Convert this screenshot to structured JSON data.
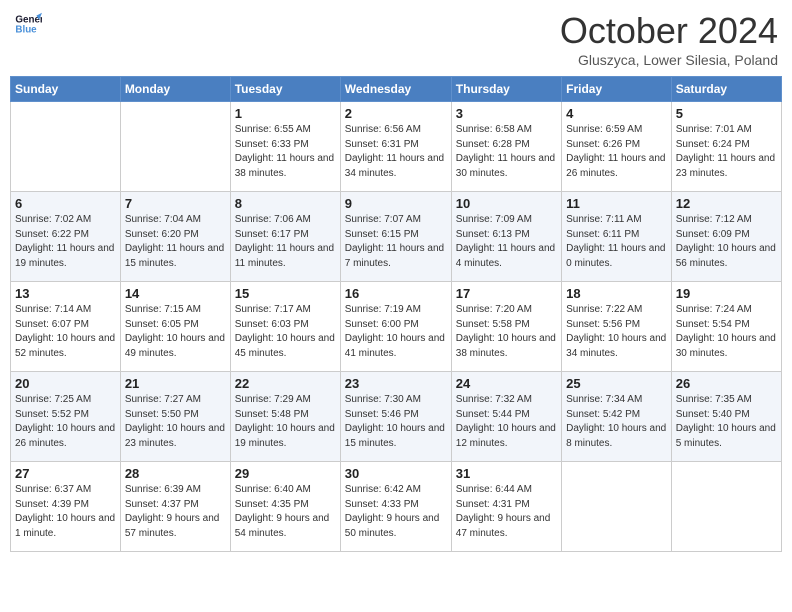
{
  "header": {
    "logo_line1": "General",
    "logo_line2": "Blue",
    "month": "October 2024",
    "location": "Gluszyca, Lower Silesia, Poland"
  },
  "weekdays": [
    "Sunday",
    "Monday",
    "Tuesday",
    "Wednesday",
    "Thursday",
    "Friday",
    "Saturday"
  ],
  "weeks": [
    [
      {
        "day": "",
        "sunrise": "",
        "sunset": "",
        "daylight": ""
      },
      {
        "day": "",
        "sunrise": "",
        "sunset": "",
        "daylight": ""
      },
      {
        "day": "1",
        "sunrise": "Sunrise: 6:55 AM",
        "sunset": "Sunset: 6:33 PM",
        "daylight": "Daylight: 11 hours and 38 minutes."
      },
      {
        "day": "2",
        "sunrise": "Sunrise: 6:56 AM",
        "sunset": "Sunset: 6:31 PM",
        "daylight": "Daylight: 11 hours and 34 minutes."
      },
      {
        "day": "3",
        "sunrise": "Sunrise: 6:58 AM",
        "sunset": "Sunset: 6:28 PM",
        "daylight": "Daylight: 11 hours and 30 minutes."
      },
      {
        "day": "4",
        "sunrise": "Sunrise: 6:59 AM",
        "sunset": "Sunset: 6:26 PM",
        "daylight": "Daylight: 11 hours and 26 minutes."
      },
      {
        "day": "5",
        "sunrise": "Sunrise: 7:01 AM",
        "sunset": "Sunset: 6:24 PM",
        "daylight": "Daylight: 11 hours and 23 minutes."
      }
    ],
    [
      {
        "day": "6",
        "sunrise": "Sunrise: 7:02 AM",
        "sunset": "Sunset: 6:22 PM",
        "daylight": "Daylight: 11 hours and 19 minutes."
      },
      {
        "day": "7",
        "sunrise": "Sunrise: 7:04 AM",
        "sunset": "Sunset: 6:20 PM",
        "daylight": "Daylight: 11 hours and 15 minutes."
      },
      {
        "day": "8",
        "sunrise": "Sunrise: 7:06 AM",
        "sunset": "Sunset: 6:17 PM",
        "daylight": "Daylight: 11 hours and 11 minutes."
      },
      {
        "day": "9",
        "sunrise": "Sunrise: 7:07 AM",
        "sunset": "Sunset: 6:15 PM",
        "daylight": "Daylight: 11 hours and 7 minutes."
      },
      {
        "day": "10",
        "sunrise": "Sunrise: 7:09 AM",
        "sunset": "Sunset: 6:13 PM",
        "daylight": "Daylight: 11 hours and 4 minutes."
      },
      {
        "day": "11",
        "sunrise": "Sunrise: 7:11 AM",
        "sunset": "Sunset: 6:11 PM",
        "daylight": "Daylight: 11 hours and 0 minutes."
      },
      {
        "day": "12",
        "sunrise": "Sunrise: 7:12 AM",
        "sunset": "Sunset: 6:09 PM",
        "daylight": "Daylight: 10 hours and 56 minutes."
      }
    ],
    [
      {
        "day": "13",
        "sunrise": "Sunrise: 7:14 AM",
        "sunset": "Sunset: 6:07 PM",
        "daylight": "Daylight: 10 hours and 52 minutes."
      },
      {
        "day": "14",
        "sunrise": "Sunrise: 7:15 AM",
        "sunset": "Sunset: 6:05 PM",
        "daylight": "Daylight: 10 hours and 49 minutes."
      },
      {
        "day": "15",
        "sunrise": "Sunrise: 7:17 AM",
        "sunset": "Sunset: 6:03 PM",
        "daylight": "Daylight: 10 hours and 45 minutes."
      },
      {
        "day": "16",
        "sunrise": "Sunrise: 7:19 AM",
        "sunset": "Sunset: 6:00 PM",
        "daylight": "Daylight: 10 hours and 41 minutes."
      },
      {
        "day": "17",
        "sunrise": "Sunrise: 7:20 AM",
        "sunset": "Sunset: 5:58 PM",
        "daylight": "Daylight: 10 hours and 38 minutes."
      },
      {
        "day": "18",
        "sunrise": "Sunrise: 7:22 AM",
        "sunset": "Sunset: 5:56 PM",
        "daylight": "Daylight: 10 hours and 34 minutes."
      },
      {
        "day": "19",
        "sunrise": "Sunrise: 7:24 AM",
        "sunset": "Sunset: 5:54 PM",
        "daylight": "Daylight: 10 hours and 30 minutes."
      }
    ],
    [
      {
        "day": "20",
        "sunrise": "Sunrise: 7:25 AM",
        "sunset": "Sunset: 5:52 PM",
        "daylight": "Daylight: 10 hours and 26 minutes."
      },
      {
        "day": "21",
        "sunrise": "Sunrise: 7:27 AM",
        "sunset": "Sunset: 5:50 PM",
        "daylight": "Daylight: 10 hours and 23 minutes."
      },
      {
        "day": "22",
        "sunrise": "Sunrise: 7:29 AM",
        "sunset": "Sunset: 5:48 PM",
        "daylight": "Daylight: 10 hours and 19 minutes."
      },
      {
        "day": "23",
        "sunrise": "Sunrise: 7:30 AM",
        "sunset": "Sunset: 5:46 PM",
        "daylight": "Daylight: 10 hours and 15 minutes."
      },
      {
        "day": "24",
        "sunrise": "Sunrise: 7:32 AM",
        "sunset": "Sunset: 5:44 PM",
        "daylight": "Daylight: 10 hours and 12 minutes."
      },
      {
        "day": "25",
        "sunrise": "Sunrise: 7:34 AM",
        "sunset": "Sunset: 5:42 PM",
        "daylight": "Daylight: 10 hours and 8 minutes."
      },
      {
        "day": "26",
        "sunrise": "Sunrise: 7:35 AM",
        "sunset": "Sunset: 5:40 PM",
        "daylight": "Daylight: 10 hours and 5 minutes."
      }
    ],
    [
      {
        "day": "27",
        "sunrise": "Sunrise: 6:37 AM",
        "sunset": "Sunset: 4:39 PM",
        "daylight": "Daylight: 10 hours and 1 minute."
      },
      {
        "day": "28",
        "sunrise": "Sunrise: 6:39 AM",
        "sunset": "Sunset: 4:37 PM",
        "daylight": "Daylight: 9 hours and 57 minutes."
      },
      {
        "day": "29",
        "sunrise": "Sunrise: 6:40 AM",
        "sunset": "Sunset: 4:35 PM",
        "daylight": "Daylight: 9 hours and 54 minutes."
      },
      {
        "day": "30",
        "sunrise": "Sunrise: 6:42 AM",
        "sunset": "Sunset: 4:33 PM",
        "daylight": "Daylight: 9 hours and 50 minutes."
      },
      {
        "day": "31",
        "sunrise": "Sunrise: 6:44 AM",
        "sunset": "Sunset: 4:31 PM",
        "daylight": "Daylight: 9 hours and 47 minutes."
      },
      {
        "day": "",
        "sunrise": "",
        "sunset": "",
        "daylight": ""
      },
      {
        "day": "",
        "sunrise": "",
        "sunset": "",
        "daylight": ""
      }
    ]
  ]
}
